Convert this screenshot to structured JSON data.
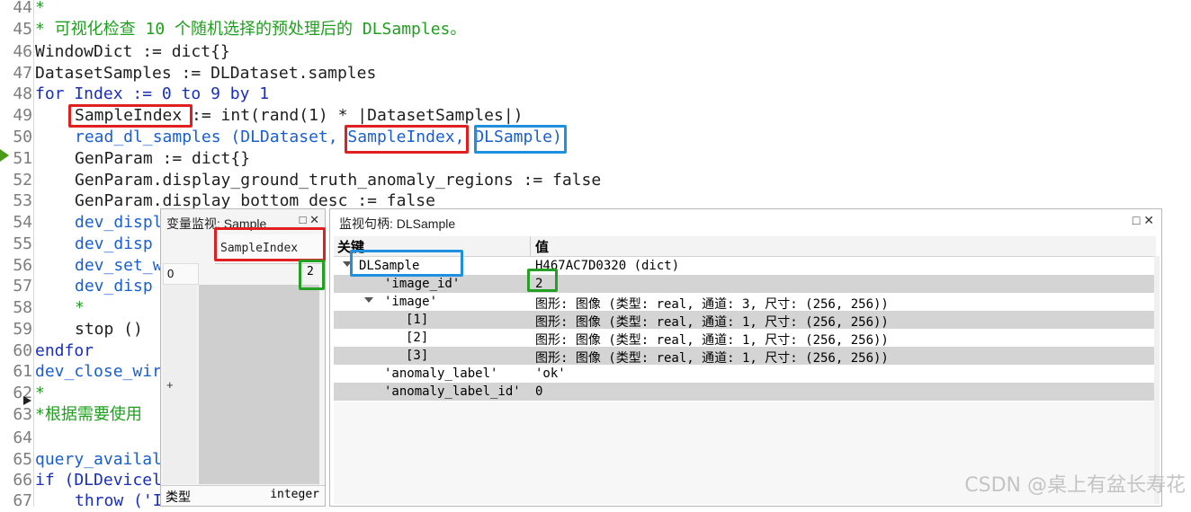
{
  "editor": {
    "lines": [
      {
        "n": "44",
        "text": "*"
      },
      {
        "n": "45",
        "text": "* 可视化检查 10 个随机选择的预处理后的 DLSamples。"
      },
      {
        "n": "46",
        "text": "WindowDict := dict{}"
      },
      {
        "n": "47",
        "text": "DatasetSamples := DLDataset.samples"
      },
      {
        "n": "48",
        "text": "for Index := 0 to 9 by 1"
      },
      {
        "n": "49",
        "text": "SampleIndex := int(rand(1) * |DatasetSamples|)"
      },
      {
        "n": "50",
        "text": "read_dl_samples (DLDataset, SampleIndex, DLSample)"
      },
      {
        "n": "51",
        "text": "GenParam := dict{}"
      },
      {
        "n": "52",
        "text": "GenParam.display_ground_truth_anomaly_regions := false"
      },
      {
        "n": "53",
        "text": "GenParam.display_bottom_desc := false"
      },
      {
        "n": "54",
        "text": "dev_displ"
      },
      {
        "n": "55",
        "text": "dev_disp"
      },
      {
        "n": "56",
        "text": "dev_set_w"
      },
      {
        "n": "57",
        "text": "dev_disp"
      },
      {
        "n": "58",
        "text": "*"
      },
      {
        "n": "59",
        "text": "stop ()"
      },
      {
        "n": "60",
        "text": "endfor"
      },
      {
        "n": "61",
        "text": "dev_close_wir"
      },
      {
        "n": "62",
        "text": "*"
      },
      {
        "n": "63",
        "text": "*根据需要使用"
      },
      {
        "n": "64",
        "text": ""
      },
      {
        "n": "65",
        "text": "query_availal"
      },
      {
        "n": "66",
        "text": "if (DLDevicel"
      },
      {
        "n": "67",
        "text": "throw ('I"
      }
    ]
  },
  "var_panel": {
    "title": "变量监视: Sample",
    "dock_icon": "□",
    "close_icon": "✕",
    "column": "SampleIndex",
    "row_index": "0",
    "value": "2",
    "expand": "+",
    "type_label": "类型",
    "type_value": "integer"
  },
  "handle_panel": {
    "title": "监视句柄: DLSample",
    "dock_icon": "□",
    "close_icon": "✕",
    "col_key": "关键",
    "col_value": "值",
    "rows": [
      {
        "key": "DLSample",
        "value": "H467AC7D0320 (dict)"
      },
      {
        "key": "'image_id'",
        "value": "2"
      },
      {
        "key": "'image'",
        "value": "图形: 图像 (类型: real, 通道: 3, 尺寸: (256, 256))"
      },
      {
        "key": "[1]",
        "value": "图形: 图像 (类型: real, 通道: 1, 尺寸: (256, 256))"
      },
      {
        "key": "[2]",
        "value": "图形: 图像 (类型: real, 通道: 1, 尺寸: (256, 256))"
      },
      {
        "key": "[3]",
        "value": "图形: 图像 (类型: real, 通道: 1, 尺寸: (256, 256))"
      },
      {
        "key": "'anomaly_label'",
        "value": "'ok'"
      },
      {
        "key": "'anomaly_label_id'",
        "value": "0"
      }
    ]
  },
  "watermark": "CSDN @桌上有盆长寿花",
  "colors": {
    "highlight_red": "#e02020",
    "highlight_blue": "#1e90e0",
    "highlight_green": "#24a024",
    "comment": "#1ea01e"
  }
}
